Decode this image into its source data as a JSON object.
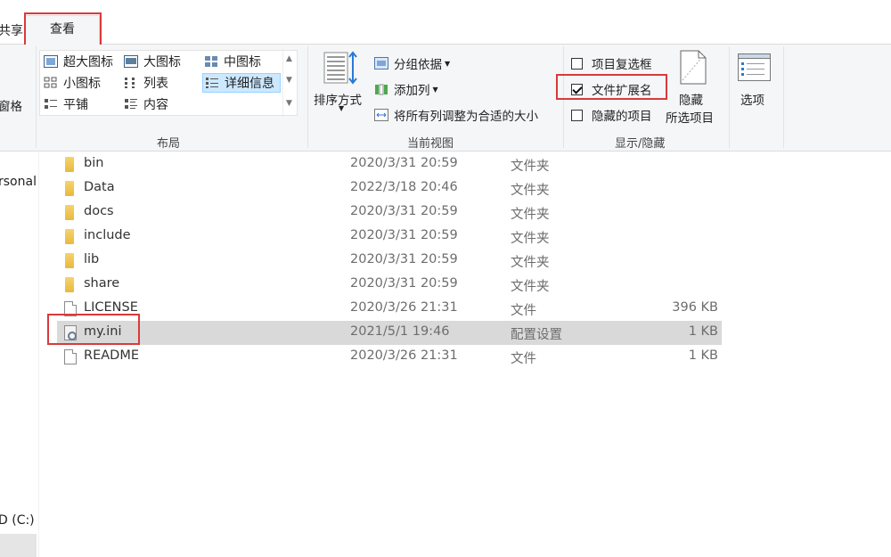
{
  "tabs": {
    "share": "共享",
    "view": "查看"
  },
  "layout_group": {
    "label": "布局",
    "items": [
      {
        "label": "超大图标",
        "icon": "extra-large-icons-icon"
      },
      {
        "label": "大图标",
        "icon": "large-icons-icon"
      },
      {
        "label": "中图标",
        "icon": "medium-icons-icon"
      },
      {
        "label": "小图标",
        "icon": "small-icons-icon"
      },
      {
        "label": "列表",
        "icon": "list-icon"
      },
      {
        "label": "详细信息",
        "icon": "details-icon"
      },
      {
        "label": "平铺",
        "icon": "tiles-icon"
      },
      {
        "label": "内容",
        "icon": "content-icon"
      }
    ],
    "selected": "详细信息"
  },
  "pane_label": "窗格",
  "current_view": {
    "label": "当前视图",
    "sort_by": "排序方式",
    "group_by": "分组依据",
    "add_columns": "添加列",
    "size_all_columns": "将所有列调整为合适的大小"
  },
  "show_hide": {
    "label": "显示/隐藏",
    "item_checkboxes": {
      "label": "项目复选框",
      "checked": false
    },
    "file_extensions": {
      "label": "文件扩展名",
      "checked": true
    },
    "hidden_items": {
      "label": "隐藏的项目",
      "checked": false
    },
    "hide_selected_line1": "隐藏",
    "hide_selected_line2": "所选项目"
  },
  "options": "选项",
  "nav": {
    "personal": "rsonal",
    "drive": "D (C:)"
  },
  "files": [
    {
      "name": "bin",
      "date": "2020/3/31 20:59",
      "type": "文件夹",
      "size": "",
      "kind": "folder"
    },
    {
      "name": "Data",
      "date": "2022/3/18 20:46",
      "type": "文件夹",
      "size": "",
      "kind": "folder"
    },
    {
      "name": "docs",
      "date": "2020/3/31 20:59",
      "type": "文件夹",
      "size": "",
      "kind": "folder"
    },
    {
      "name": "include",
      "date": "2020/3/31 20:59",
      "type": "文件夹",
      "size": "",
      "kind": "folder"
    },
    {
      "name": "lib",
      "date": "2020/3/31 20:59",
      "type": "文件夹",
      "size": "",
      "kind": "folder"
    },
    {
      "name": "share",
      "date": "2020/3/31 20:59",
      "type": "文件夹",
      "size": "",
      "kind": "folder"
    },
    {
      "name": "LICENSE",
      "date": "2020/3/26 21:31",
      "type": "文件",
      "size": "396 KB",
      "kind": "file"
    },
    {
      "name": "my.ini",
      "date": "2021/5/1 19:46",
      "type": "配置设置",
      "size": "1 KB",
      "kind": "ini"
    },
    {
      "name": "README",
      "date": "2020/3/26 21:31",
      "type": "文件",
      "size": "1 KB",
      "kind": "file"
    }
  ],
  "selected_file": "my.ini",
  "colors": {
    "highlight": "#d93a3a",
    "selection": "#d9d9d9",
    "gallery_selection": "#cce8ff"
  }
}
